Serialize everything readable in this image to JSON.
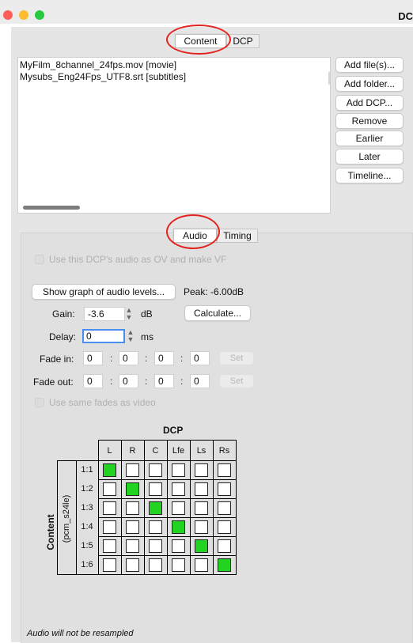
{
  "window": {
    "title": "DC",
    "traffic_colors": [
      "#fe5f57",
      "#febc2e",
      "#28c840"
    ]
  },
  "main_tabs": [
    {
      "label": "Content",
      "selected": true
    },
    {
      "label": "DCP",
      "selected": false
    }
  ],
  "files": [
    "MyFilm_8channel_24fps.mov [movie]",
    "Mysubs_Eng24Fps_UTF8.srt [subtitles]"
  ],
  "side_buttons": [
    "Add file(s)...",
    "Add folder...",
    "Add DCP...",
    "Remove",
    "Earlier",
    "Later",
    "Timeline..."
  ],
  "audio_tabs": [
    {
      "label": "Audio",
      "selected": true
    },
    {
      "label": "Timing",
      "selected": false
    }
  ],
  "audio": {
    "use_dcp_audio_label": "Use this DCP's audio as OV and make VF",
    "show_graph_label": "Show graph of audio levels...",
    "peak_text": "Peak: -6.00dB",
    "gain_label": "Gain:",
    "gain_value": "-3.6",
    "gain_unit": "dB",
    "calculate_label": "Calculate...",
    "delay_label": "Delay:",
    "delay_value": "0",
    "delay_unit": "ms",
    "fade_in_label": "Fade in:",
    "fade_in": [
      "0",
      "0",
      "0",
      "0"
    ],
    "fade_out_label": "Fade out:",
    "fade_out": [
      "0",
      "0",
      "0",
      "0"
    ],
    "set_label": "Set",
    "colon": ":",
    "same_fades_label": "Use same fades as video",
    "resample_note": "Audio will not be resampled"
  },
  "matrix": {
    "dcp_label": "DCP",
    "content_label": "Content",
    "stream_label": "(pcm_s24le)",
    "columns": [
      "L",
      "R",
      "C",
      "Lfe",
      "Ls",
      "Rs"
    ],
    "rows": [
      "1:1",
      "1:2",
      "1:3",
      "1:4",
      "1:5",
      "1:6"
    ],
    "mapping_color": "#22d322",
    "checked": [
      [
        true,
        false,
        false,
        false,
        false,
        false
      ],
      [
        false,
        true,
        false,
        false,
        false,
        false
      ],
      [
        false,
        false,
        true,
        false,
        false,
        false
      ],
      [
        false,
        false,
        false,
        true,
        false,
        false
      ],
      [
        false,
        false,
        false,
        false,
        true,
        false
      ],
      [
        false,
        false,
        false,
        false,
        false,
        true
      ]
    ]
  },
  "annotation_color": "#e3231e"
}
